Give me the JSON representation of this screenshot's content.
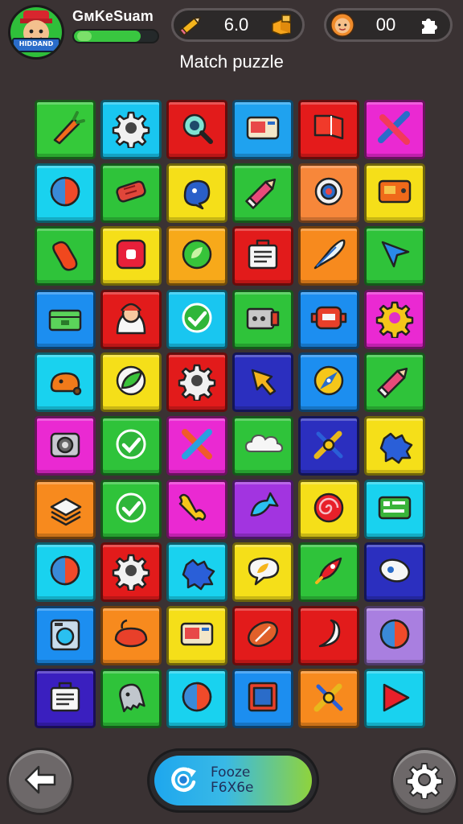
{
  "hud": {
    "player_name": "GмKeSuam",
    "avatar_banner": "HIDDAND",
    "xp_fraction": 0.8,
    "coins_value": "6.0",
    "lives_value": "00",
    "icons": {
      "coins": "pencil-icon",
      "coins_extra": "gold-bar-icon",
      "lives": "face-coin-icon",
      "lives_extra": "puzzle-piece-icon"
    }
  },
  "title": "Match puzzle",
  "board": {
    "rows": 10,
    "cols": 6,
    "tiles": [
      {
        "color": "#35c93a",
        "icon": "carrot-icon"
      },
      {
        "color": "#19c6f0",
        "icon": "gear-icon"
      },
      {
        "color": "#e21b1b",
        "icon": "magnifier-icon"
      },
      {
        "color": "#1fa2ef",
        "icon": "card-icon"
      },
      {
        "color": "#e41b1b",
        "icon": "flag-icon"
      },
      {
        "color": "#ea29d2",
        "icon": "cross-swords-icon"
      },
      {
        "color": "#19d2ef",
        "icon": "ball-icon"
      },
      {
        "color": "#2fc33a",
        "icon": "log-icon"
      },
      {
        "color": "#f5df19",
        "icon": "creature-icon"
      },
      {
        "color": "#2fc33a",
        "icon": "pencil-icon"
      },
      {
        "color": "#f7873a",
        "icon": "ring-icon"
      },
      {
        "color": "#f5df19",
        "icon": "box-icon"
      },
      {
        "color": "#2fc33a",
        "icon": "bean-icon"
      },
      {
        "color": "#f5df19",
        "icon": "button-icon"
      },
      {
        "color": "#f7a91a",
        "icon": "leaf-coin-icon"
      },
      {
        "color": "#e21b1b",
        "icon": "bag-icon"
      },
      {
        "color": "#f78a1e",
        "icon": "feather-icon"
      },
      {
        "color": "#2fc33a",
        "icon": "arrow-cursor-icon"
      },
      {
        "color": "#1c8ef0",
        "icon": "chest-icon"
      },
      {
        "color": "#e21b1b",
        "icon": "hero-icon"
      },
      {
        "color": "#19c6f0",
        "icon": "check-icon"
      },
      {
        "color": "#2fc33a",
        "icon": "machine-icon"
      },
      {
        "color": "#1c8ef0",
        "icon": "robot-icon"
      },
      {
        "color": "#ea29d2",
        "icon": "sun-gear-icon"
      },
      {
        "color": "#19d2ef",
        "icon": "blob-icon"
      },
      {
        "color": "#f5df19",
        "icon": "leaf-icon"
      },
      {
        "color": "#e21b1b",
        "icon": "gear-icon"
      },
      {
        "color": "#2b2fbf",
        "icon": "arrow-icon"
      },
      {
        "color": "#1c8ef0",
        "icon": "compass-icon"
      },
      {
        "color": "#2fc33a",
        "icon": "pencil-icon"
      },
      {
        "color": "#ea29d2",
        "icon": "camera-icon"
      },
      {
        "color": "#2fc33a",
        "icon": "check-icon"
      },
      {
        "color": "#ea29d2",
        "icon": "cross-icon"
      },
      {
        "color": "#2fc33a",
        "icon": "cloud-icon"
      },
      {
        "color": "#2b2fbf",
        "icon": "swords-icon"
      },
      {
        "color": "#f5df19",
        "icon": "splat-icon"
      },
      {
        "color": "#f78a1e",
        "icon": "stack-icon"
      },
      {
        "color": "#2fc33a",
        "icon": "check-icon"
      },
      {
        "color": "#ea29d2",
        "icon": "bone-icon"
      },
      {
        "color": "#a234e0",
        "icon": "fish-icon"
      },
      {
        "color": "#f5df19",
        "icon": "swirl-icon"
      },
      {
        "color": "#19d2ef",
        "icon": "board-icon"
      },
      {
        "color": "#19d2ef",
        "icon": "ball-icon"
      },
      {
        "color": "#e21b1b",
        "icon": "gear-icon"
      },
      {
        "color": "#19d2ef",
        "icon": "splat-icon"
      },
      {
        "color": "#f5df19",
        "icon": "leaf-chat-icon"
      },
      {
        "color": "#2fc33a",
        "icon": "rocket-icon"
      },
      {
        "color": "#2b2fbf",
        "icon": "egg-icon"
      },
      {
        "color": "#1c8ef0",
        "icon": "washer-icon"
      },
      {
        "color": "#f78a1e",
        "icon": "crab-icon"
      },
      {
        "color": "#f5df19",
        "icon": "card-icon"
      },
      {
        "color": "#e21b1b",
        "icon": "football-icon"
      },
      {
        "color": "#e21b1b",
        "icon": "swoosh-icon"
      },
      {
        "color": "#a97fe0",
        "icon": "ball-icon"
      },
      {
        "color": "#3a1fbf",
        "icon": "bag-icon"
      },
      {
        "color": "#2fc33a",
        "icon": "ghost-icon"
      },
      {
        "color": "#19d2ef",
        "icon": "ball-icon"
      },
      {
        "color": "#1c8ef0",
        "icon": "picture-icon"
      },
      {
        "color": "#f78a1e",
        "icon": "swords-icon"
      },
      {
        "color": "#19d2ef",
        "icon": "play-icon"
      }
    ]
  },
  "bottom": {
    "back_icon": "arrow-left-icon",
    "settings_icon": "gear-icon",
    "main_button_line1": "Fooze",
    "main_button_line2": "F6X6e",
    "main_button_icon": "refresh-icon"
  }
}
